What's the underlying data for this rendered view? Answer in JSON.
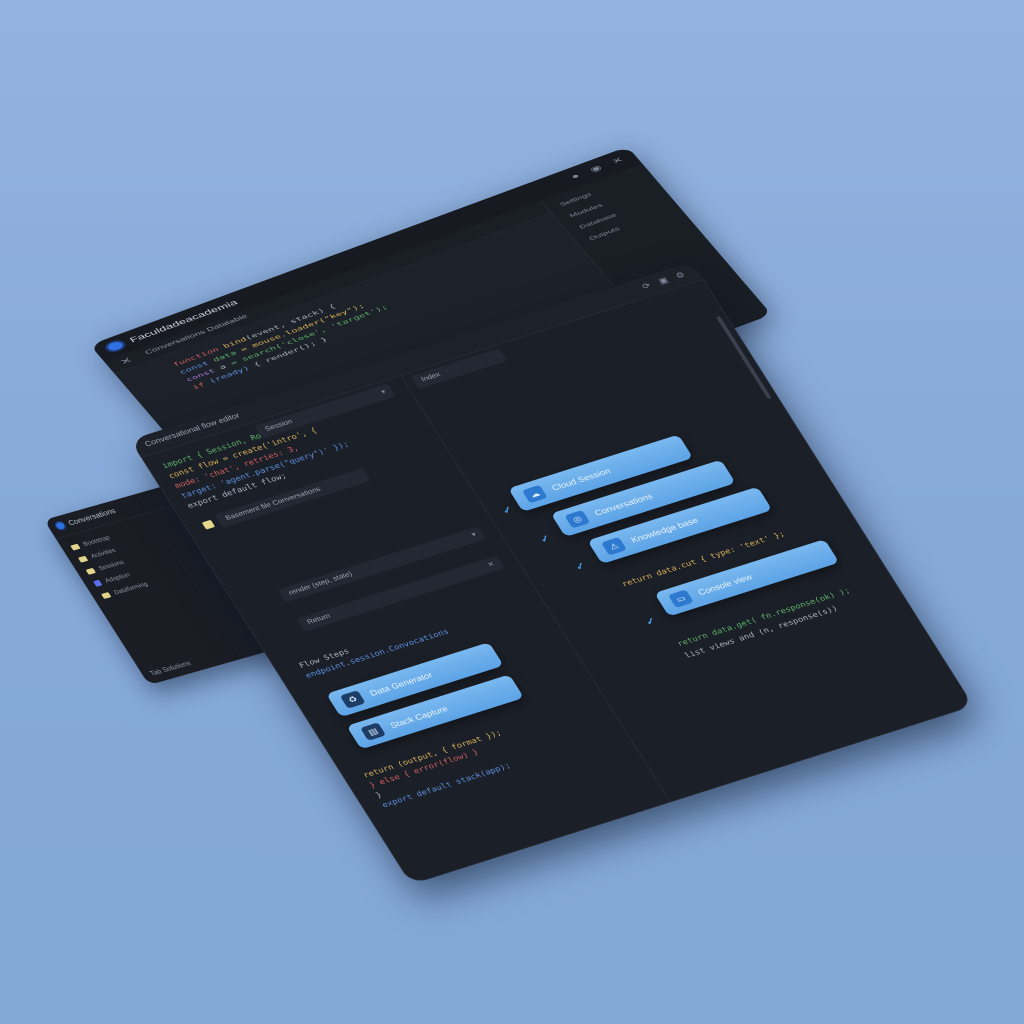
{
  "back_window": {
    "title": "Faculdadeacademia",
    "tab_label": "Conversations Datatable",
    "header_icons": [
      "circle-icon",
      "globe-icon",
      "close-icon"
    ],
    "code_lines": [
      [
        "function",
        " bind",
        "(event, stack) {"
      ],
      [
        "const",
        " data",
        " = mouse.loader(\"key\");"
      ],
      [
        "const",
        " a",
        " = search('close', 'target');"
      ],
      [
        "if",
        " (ready)",
        " { render(); }"
      ]
    ],
    "sidebar_items": [
      "Settings",
      "Modules",
      "Database",
      "Outputs"
    ]
  },
  "left_window": {
    "title": "Conversations",
    "tree": [
      {
        "type": "folder",
        "label": "Bootstrap"
      },
      {
        "type": "folder",
        "label": "Activities"
      },
      {
        "type": "folder",
        "label": "Sessions"
      },
      {
        "type": "file",
        "label": "Adoption"
      },
      {
        "type": "folder",
        "label": "Dataforming"
      }
    ],
    "footer": "Tab Solutions"
  },
  "main_window": {
    "toolbar_text": "Conversational flow editor",
    "toolbar_icons": [
      "sync-icon",
      "layout-icon",
      "settings-icon"
    ],
    "left_pane": {
      "code_lines": [
        "import { Session, Router } from 'core';",
        "const flow = create('intro', {",
        "  mode: 'chat', retries: 3,",
        "  target: 'agent.parse(\"query\")' });",
        "export default flow;"
      ],
      "crumb_top": "Session",
      "note_label": "Basement file Conversations",
      "crumb_mid": "render (step, state)",
      "crumb_low": "Return",
      "func_label": "Flow Steps",
      "flow_path": "endpoint.session.Convocations",
      "buttons": [
        {
          "label": "Data Generator",
          "icon": "recycle-icon"
        },
        {
          "label": "Stack Capture",
          "icon": "terminal-icon"
        }
      ],
      "bottom_code": [
        "return (output, { format });",
        "  } else { error(flow) }",
        "}",
        "export default stack(app);"
      ]
    },
    "right_pane": {
      "header_label": "Index",
      "buttons": [
        {
          "label": "Cloud Session",
          "icon": "cloud-icon"
        },
        {
          "label": "Conversations",
          "icon": "headset-icon"
        },
        {
          "label": "Knowledge base",
          "icon": "warning-icon"
        },
        {
          "label": "Console view",
          "icon": "monitor-icon"
        }
      ],
      "code_mid": "return data.cut { type: 'text' };",
      "code_low": "return data.get( fn.response(ok) );",
      "code_tail": "list views and (n, response(s))"
    }
  }
}
